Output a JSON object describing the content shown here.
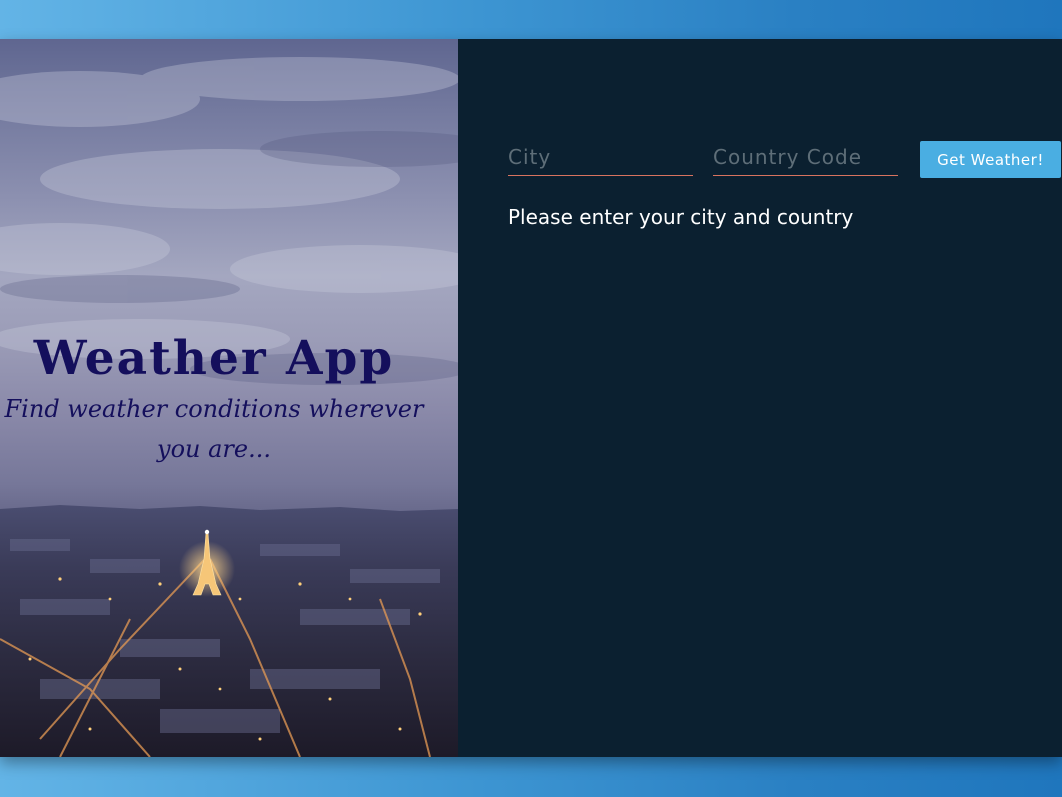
{
  "hero": {
    "title": "Weather App",
    "subtitle": "Find weather conditions wherever you are..."
  },
  "form": {
    "city_placeholder": "City",
    "country_placeholder": "Country Code",
    "submit_label": "Get Weather!"
  },
  "status": {
    "message": "Please enter your city and country"
  },
  "colors": {
    "panel_bg": "#0b2030",
    "accent_button": "#4aaee2",
    "input_underline": "#d8735f",
    "hero_title": "#140f5c",
    "page_bg": "#3d95d2"
  }
}
